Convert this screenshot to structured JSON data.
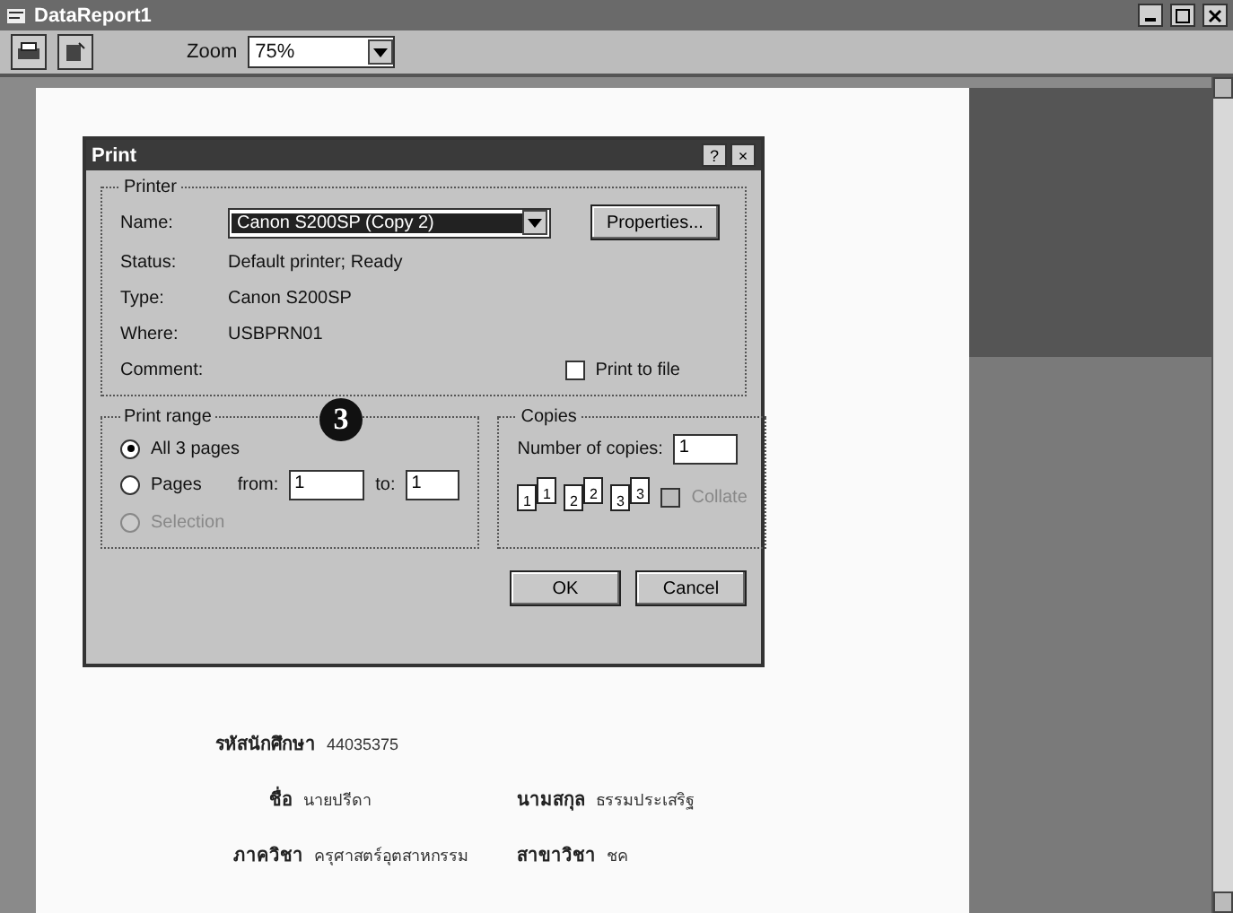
{
  "window": {
    "title": "DataReport1"
  },
  "toolbar": {
    "zoom_label": "Zoom",
    "zoom_value": "75%"
  },
  "report": {
    "fields": [
      {
        "label": "รหัสนักศึกษา",
        "value": "44035375"
      },
      {
        "label": "ชื่อ",
        "value": "นายปรีดา",
        "label2": "นามสกุล",
        "value2": "ธรรมประเสริฐ"
      },
      {
        "label": "ภาควิชา",
        "value": "ครุศาสตร์อุตสาหกรรม",
        "label2": "สาขาวิชา",
        "value2": "ชค"
      }
    ]
  },
  "callout": "3",
  "dialog": {
    "title": "Print",
    "help": "?",
    "close": "×",
    "printer": {
      "group": "Printer",
      "name_label": "Name:",
      "name_value": "Canon S200SP (Copy 2)",
      "properties": "Properties...",
      "info": [
        {
          "label": "Status:",
          "value": "Default printer; Ready"
        },
        {
          "label": "Type:",
          "value": "Canon S200SP"
        },
        {
          "label": "Where:",
          "value": "USBPRN01"
        },
        {
          "label": "Comment:"
        }
      ],
      "print_to_file": {
        "label": "Print to file",
        "checked": false
      }
    },
    "range": {
      "group": "Print range",
      "options": [
        {
          "label": "All 3 pages",
          "selected": true,
          "disabled": false
        },
        {
          "label": "Pages",
          "selected": false,
          "disabled": false
        },
        {
          "label": "Selection",
          "selected": false,
          "disabled": true
        }
      ],
      "from_label": "from:",
      "from_value": "1",
      "to_label": "to:",
      "to_value": "1"
    },
    "copies": {
      "group": "Copies",
      "count_label": "Number of copies:",
      "count_value": "1",
      "collate": {
        "label": "Collate",
        "checked": false,
        "disabled": true
      },
      "page_marks": [
        "1",
        "1",
        "2",
        "2",
        "3",
        "3"
      ]
    },
    "buttons": [
      "OK",
      "Cancel"
    ]
  }
}
